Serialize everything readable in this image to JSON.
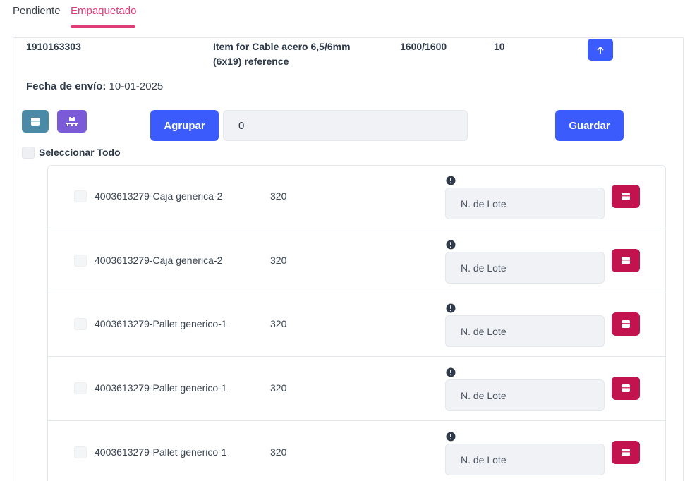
{
  "tabs": [
    {
      "label": "Pendiente",
      "active": false
    },
    {
      "label": "Empaquetado",
      "active": true
    }
  ],
  "order": {
    "number": "1910163303",
    "item_line1": "Item for Cable acero 6,5/6mm",
    "item_line2": "(6x19) reference",
    "quantity": "1600/1600",
    "count": "10"
  },
  "shipping": {
    "label": "Fecha de envío:",
    "date": "10-01-2025"
  },
  "actions": {
    "group_label": "Agrupar",
    "group_value": "0",
    "save_label": "Guardar",
    "select_all_label": "Seleccionar Todo"
  },
  "rows": [
    {
      "name": "4003613279-Caja generica-2",
      "qty": "320",
      "lot_placeholder": "N. de Lote"
    },
    {
      "name": "4003613279-Caja generica-2",
      "qty": "320",
      "lot_placeholder": "N. de Lote"
    },
    {
      "name": "4003613279-Pallet generico-1",
      "qty": "320",
      "lot_placeholder": "N. de Lote"
    },
    {
      "name": "4003613279-Pallet generico-1",
      "qty": "320",
      "lot_placeholder": "N. de Lote"
    },
    {
      "name": "4003613279-Pallet generico-1",
      "qty": "320",
      "lot_placeholder": "N. de Lote"
    }
  ],
  "icons": {
    "up": "arrow-up-icon",
    "box": "box-icon",
    "pallet": "pallet-icon",
    "warning": "exclamation-circle-icon",
    "pack": "box-icon"
  },
  "colors": {
    "active_tab": "#e03c7a",
    "primary": "#3b5bfd",
    "box_button": "#4a8aa6",
    "pallet_button": "#7a5ad6",
    "pack_button": "#c3134e"
  }
}
